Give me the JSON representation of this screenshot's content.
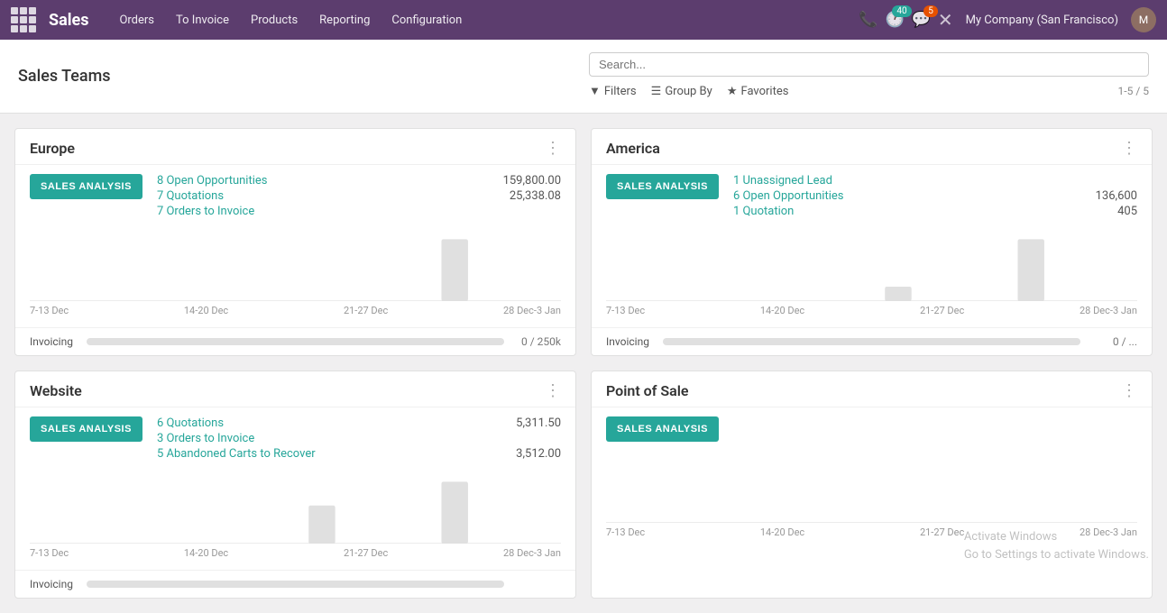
{
  "topnav": {
    "app_title": "Sales",
    "menu_items": [
      "Orders",
      "To Invoice",
      "Products",
      "Reporting",
      "Configuration"
    ],
    "badge_40": "40",
    "badge_5": "5",
    "company": "My Company (San Francisco)",
    "user_initials": "M"
  },
  "page": {
    "title": "Sales Teams",
    "search_placeholder": "Search...",
    "filters_label": "Filters",
    "groupby_label": "Group By",
    "favorites_label": "Favorites",
    "record_count": "1-5 / 5"
  },
  "cards": [
    {
      "id": "europe",
      "title": "Europe",
      "btn_label": "SALES ANALYSIS",
      "stats": [
        {
          "link": "8 Open Opportunities",
          "value": "159,800.00"
        },
        {
          "link": "7 Quotations",
          "value": "25,338.08"
        },
        {
          "link": "7 Orders to Invoice",
          "value": ""
        }
      ],
      "chart_bars": [
        0,
        0,
        0,
        65
      ],
      "chart_labels": [
        "7-13 Dec",
        "14-20 Dec",
        "21-27 Dec",
        "28 Dec-3 Jan"
      ],
      "invoicing_label": "Invoicing",
      "invoicing_progress": 0,
      "invoicing_value": "0 / 250k"
    },
    {
      "id": "america",
      "title": "America",
      "btn_label": "SALES ANALYSIS",
      "stats": [
        {
          "link": "1 Unassigned Lead",
          "value": ""
        },
        {
          "link": "6 Open Opportunities",
          "value": "136,600"
        },
        {
          "link": "1 Quotation",
          "value": "405"
        }
      ],
      "chart_bars": [
        0,
        0,
        15,
        65
      ],
      "chart_labels": [
        "7-13 Dec",
        "14-20 Dec",
        "21-27 Dec",
        "28 Dec-3 Jan"
      ],
      "invoicing_label": "Invoicing",
      "invoicing_progress": 0,
      "invoicing_value": "0 / ..."
    },
    {
      "id": "website",
      "title": "Website",
      "btn_label": "SALES ANALYSIS",
      "stats": [
        {
          "link": "6 Quotations",
          "value": "5,311.50"
        },
        {
          "link": "3 Orders to Invoice",
          "value": ""
        },
        {
          "link": "5 Abandoned Carts to Recover",
          "value": "3,512.00"
        }
      ],
      "chart_bars": [
        0,
        0,
        40,
        65
      ],
      "chart_labels": [
        "7-13 Dec",
        "14-20 Dec",
        "21-27 Dec",
        "28 Dec-3 Jan"
      ],
      "invoicing_label": "Invoicing",
      "invoicing_progress": 0,
      "invoicing_value": ""
    },
    {
      "id": "point-of-sale",
      "title": "Point of Sale",
      "btn_label": "SALES ANALYSIS",
      "stats": [],
      "chart_bars": [
        0,
        0,
        0,
        0
      ],
      "chart_labels": [
        "7-13 Dec",
        "14-20 Dec",
        "21-27 Dec",
        "28 Dec-3 Jan"
      ],
      "invoicing_label": "",
      "invoicing_progress": 0,
      "invoicing_value": ""
    }
  ],
  "watermark": {
    "line1": "Activate Windows",
    "line2": "Go to Settings to activate Windows."
  }
}
